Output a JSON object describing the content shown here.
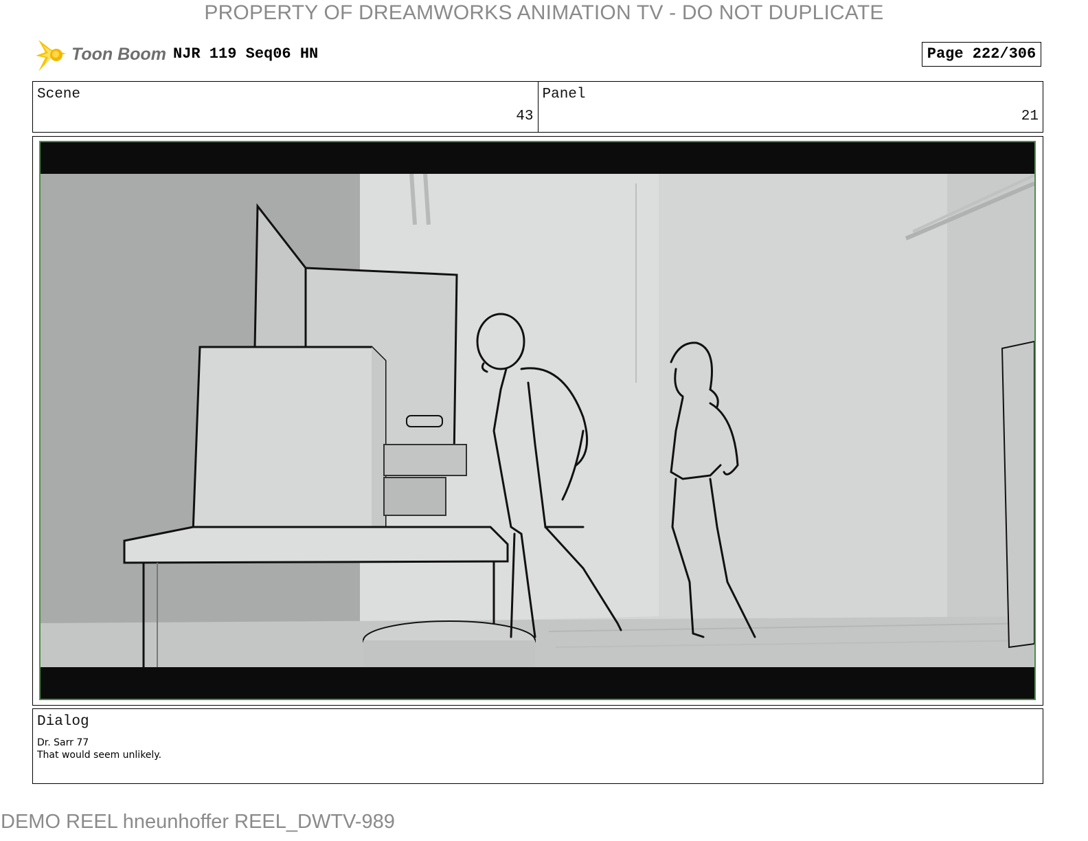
{
  "watermark": {
    "top": "PROPERTY OF DREAMWORKS ANIMATION TV - DO NOT DUPLICATE",
    "bottom": "DEMO REEL hneunhoffer REEL_DWTV-989"
  },
  "header": {
    "logo_text": "Toon Boom",
    "logo_icon": "starburst-icon",
    "title": "NJR 119 Seq06 HN",
    "page": "Page 222/306"
  },
  "info": {
    "scene_label": "Scene",
    "scene_value": "43",
    "panel_label": "Panel",
    "panel_value": "21"
  },
  "dialog": {
    "label": "Dialog",
    "speaker": "Dr. Sarr 77",
    "line": "That would seem unlikely."
  },
  "colors": {
    "watermark": "#8a8a8a",
    "logo_yellow": "#f2c200",
    "frame_green": "#4a8f4a",
    "letterbox": "#0c0c0c"
  }
}
